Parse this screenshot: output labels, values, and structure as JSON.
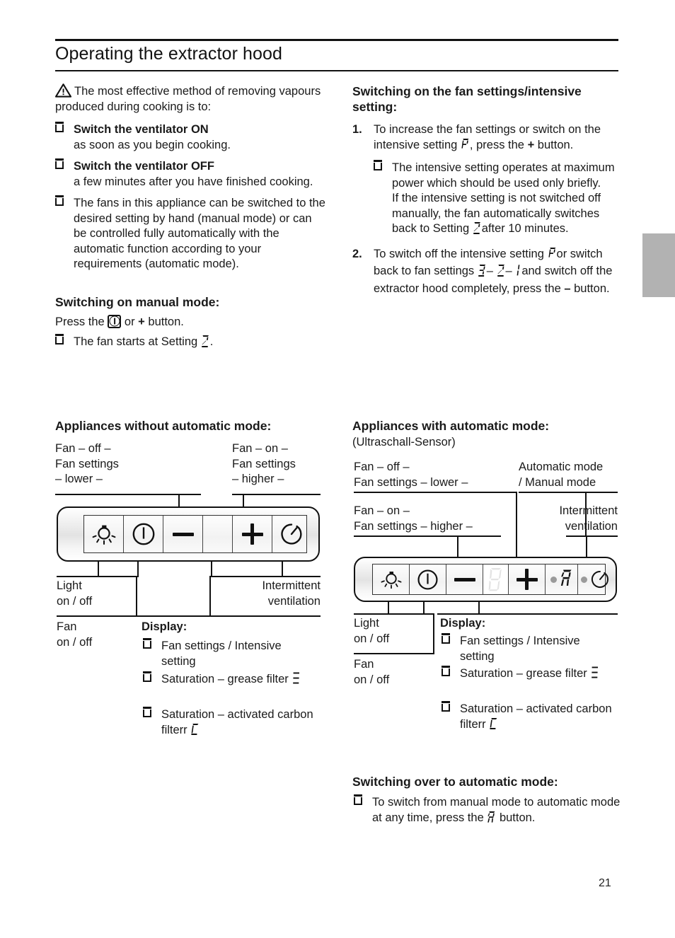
{
  "header": {
    "title": "Operating the extractor hood"
  },
  "page_number": "21",
  "left_column": {
    "intro": "The most effective method of removing vapours produced during cooking is to:",
    "bullets": [
      {
        "bold": "Switch the ventilator ON",
        "rest": "as soon as you begin cooking."
      },
      {
        "bold": "Switch the ventilator OFF",
        "rest": "a few minutes after you have finished cooking."
      }
    ],
    "bullet_plain": "The fans in this appliance can be switched to the desired setting by hand (manual mode) or can be controlled fully automatically with the automatic function according to your requirements (automatic mode).",
    "manual_mode": {
      "heading": "Switching on manual mode:",
      "press_pre": "Press the",
      "press_mid": "or",
      "press_post": "button.",
      "plus": "+",
      "bullet": "The fan starts at Setting",
      "setting_symbol": "2",
      "period": "."
    }
  },
  "right_column": {
    "fan_settings": {
      "heading": "Switching on the fan settings/intensive setting:",
      "step1": {
        "num": "1.",
        "part_a": "To increase the fan settings or switch on the intensive setting",
        "symbol": "P",
        "part_b": ", press the",
        "plus": "+",
        "part_c": "button.",
        "sub_a": "The intensive setting operates at maximum power which should be used only briefly.",
        "sub_b": "If the intensive setting is not switched off manually, the fan automatically switches back to Setting",
        "sub_symbol": "2",
        "sub_c": "after 10 minutes."
      },
      "step2": {
        "num": "2.",
        "part_a": "To switch off the intensive setting",
        "symbol_p": "P",
        "part_b": "or switch back to fan settings",
        "symbol_3": "3",
        "dash1": "–",
        "symbol_2": "2",
        "dash2": "–",
        "symbol_1": "1",
        "part_c": "and switch off the extractor hood completely, press the",
        "minus": "–",
        "part_d": "button."
      }
    },
    "auto_switch": {
      "heading": "Switching over to automatic mode:",
      "bullet_a": "To switch from manual mode to automatic mode at any time, press the",
      "symbol": "A",
      "bullet_b": "button."
    }
  },
  "diagram_left": {
    "heading": "Appliances without automatic mode:",
    "top_left_label": "Fan – off –\nFan settings\n– lower –",
    "top_right_label": "Fan – on –\nFan settings\n– higher –",
    "bottom_light": "Light\non / off",
    "bottom_fan": "Fan\non / off",
    "bottom_interval": "Intermittent\nventilation",
    "display": {
      "heading": "Display:",
      "items": [
        {
          "text": "Fan settings / Intensive setting",
          "symbol": ""
        },
        {
          "text": "Saturation – grease filter",
          "symbol": "F"
        },
        {
          "text": "Saturation – activated carbon filterr",
          "symbol": "C"
        }
      ]
    },
    "keys": [
      "light-icon",
      "power-icon",
      "minus-icon",
      "display",
      "plus-icon",
      "timer-icon"
    ]
  },
  "diagram_right": {
    "heading": "Appliances with automatic mode:",
    "subheading": "(Ultraschall-Sensor)",
    "label_off": "Fan – off –\nFan settings – lower –",
    "label_on": "Fan – on –\nFan settings – higher –",
    "label_auto": "Automatic mode\n/ Manual mode",
    "label_interval": "Intermittent\nventilation",
    "bottom_light": "Light\non / off",
    "bottom_fan": "Fan\non / off",
    "display": {
      "heading": "Display:",
      "items": [
        {
          "text": "Fan settings / Intensive setting",
          "symbol": ""
        },
        {
          "text": "Saturation – grease filter",
          "symbol": "F"
        },
        {
          "text": "Saturation – activated carbon filterr",
          "symbol": "C"
        }
      ]
    },
    "keys": [
      "light-icon",
      "power-icon",
      "minus-icon",
      "seven-segment-display",
      "plus-icon",
      "auto-mode-icon",
      "timer-icon"
    ]
  },
  "colors": {
    "ink": "#111111",
    "tab_gray": "#b2b2b2",
    "led_gray": "#9a9a9a"
  }
}
